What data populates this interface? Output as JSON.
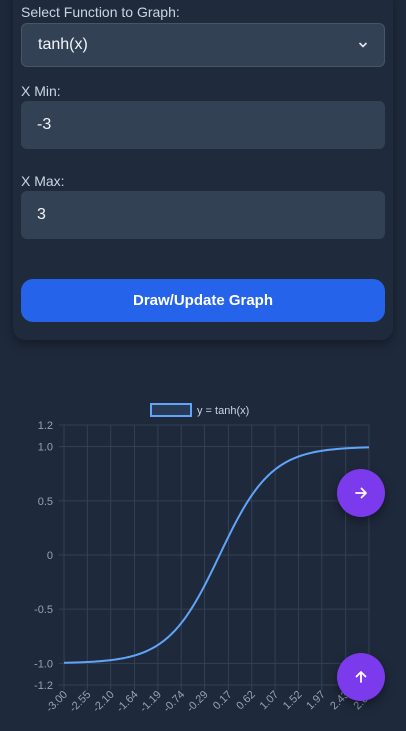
{
  "form": {
    "function_label": "Select Function to Graph:",
    "function_value": "tanh(x)",
    "xmin_label": "X Min:",
    "xmin_value": "-3",
    "xmax_label": "X Max:",
    "xmax_value": "3",
    "draw_button": "Draw/Update Graph"
  },
  "fabs": {
    "next_icon": "arrow-right-icon",
    "top_icon": "arrow-up-icon",
    "color": "#7c3aed"
  },
  "chart_data": {
    "type": "line",
    "function": "tanh",
    "legend": [
      "y = tanh(x)"
    ],
    "legend_position": "top-center",
    "line_color": "#60a5fa",
    "grid": true,
    "xlim": [
      -3.0,
      2.88
    ],
    "ylim": [
      -1.2,
      1.2
    ],
    "x_tick_labels": [
      "-3.00",
      "-2.55",
      "-2.10",
      "-1.64",
      "-1.19",
      "-0.74",
      "-0.29",
      "0.17",
      "0.62",
      "1.07",
      "1.52",
      "1.97",
      "2.43",
      "2.88"
    ],
    "y_tick_labels": [
      "1.2",
      "1.0",
      "0.5",
      "0",
      "-0.5",
      "-1.0",
      "-1.2"
    ],
    "y_tick_values": [
      1.2,
      1.0,
      0.5,
      0,
      -0.5,
      -1.0,
      -1.2
    ]
  }
}
